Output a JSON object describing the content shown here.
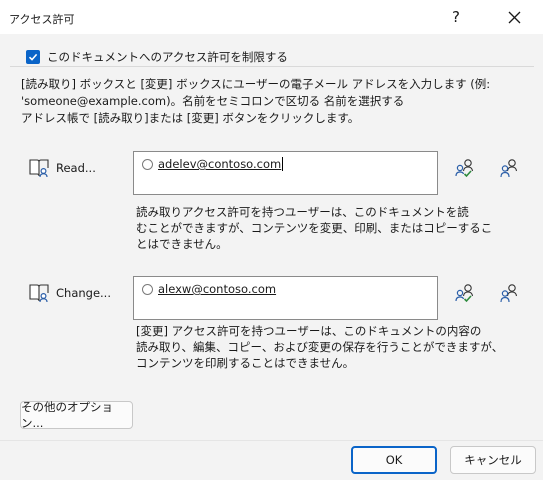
{
  "window": {
    "title": "アクセス許可",
    "help_label": "?"
  },
  "restrict": {
    "checked": true,
    "label": "このドキュメントへのアクセス許可を制限する"
  },
  "instructions": {
    "line1": "[読み取り] ボックスと [変更] ボックスにユーザーの電子メール アドレスを入力します (例:",
    "line2": "'someone@example.com)。名前をセミコロンで区切る 名前を選択する",
    "line3": "アドレス帳で [読み取り]または [変更] ボタンをクリックします。"
  },
  "read": {
    "button_label": "Read...",
    "user": "adelev@contoso.com",
    "desc_line1": "読み取りアクセス許可を持つユーザーは、このドキュメントを読",
    "desc_line2": "むことができますが、コンテンツを変更、印刷、またはコピーするこ",
    "desc_line3": "とはできません。"
  },
  "change": {
    "button_label": "Change...",
    "user": "alexw@contoso.com",
    "desc_line1": "[変更] アクセス許可を持つユーザーは、このドキュメントの内容の",
    "desc_line2": "読み取り、編集、コピー、および変更の保存を行うことができますが、",
    "desc_line3": "コンテンツを印刷することはできません。"
  },
  "buttons": {
    "more_options": "その他のオプション...",
    "ok": "OK",
    "cancel": "キャンセル"
  },
  "colors": {
    "accent": "#0a64c8",
    "check_green": "#2e8b3e",
    "icon_blue": "#2a5ea8"
  }
}
